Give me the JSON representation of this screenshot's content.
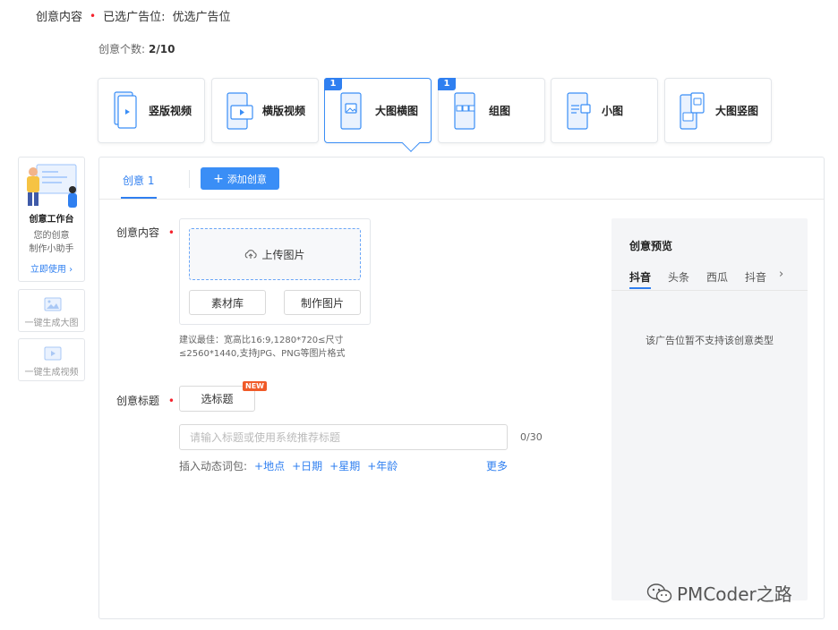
{
  "header": {
    "content_label": "创意内容",
    "selected_label": "已选广告位:",
    "selected_value": "优选广告位"
  },
  "creative_count": {
    "label": "创意个数:",
    "value": "2/10"
  },
  "ad_types": [
    {
      "label": "竖版视频",
      "badge": "",
      "icon": "vertical-video-icon"
    },
    {
      "label": "横版视频",
      "badge": "",
      "icon": "horizontal-video-icon"
    },
    {
      "label": "大图横图",
      "badge": "1",
      "icon": "large-horizontal-image-icon",
      "active": true
    },
    {
      "label": "组图",
      "badge": "1",
      "icon": "image-group-icon"
    },
    {
      "label": "小图",
      "badge": "",
      "icon": "small-image-icon"
    },
    {
      "label": "大图竖图",
      "badge": "",
      "icon": "large-vertical-image-icon"
    }
  ],
  "assistant": {
    "title": "创意工作台",
    "line1": "您的创意",
    "line2": "制作小助手",
    "cta": "立即使用 ›"
  },
  "tools": [
    {
      "label": "一键生成大图",
      "icon": "image-icon"
    },
    {
      "label": "一键生成视频",
      "icon": "video-icon"
    }
  ],
  "tabs": {
    "active_tab": "创意 1",
    "add_label": "添加创意"
  },
  "content_section": {
    "label": "创意内容",
    "upload_label": "上传图片",
    "library_label": "素材库",
    "make_label": "制作图片",
    "hint": "建议最佳：宽高比16:9,1280*720≤尺寸≤2560*1440,支持JPG、PNG等图片格式"
  },
  "title_section": {
    "label": "创意标题",
    "pick_label": "选标题",
    "new_badge": "NEW",
    "input_placeholder": "请输入标题或使用系统推荐标题",
    "input_value": "",
    "counter": "0/30",
    "dynamic_label": "插入动态词包:",
    "dynamic_words": [
      "+地点",
      "+日期",
      "+星期",
      "+年龄"
    ],
    "more_label": "更多"
  },
  "preview": {
    "title": "创意预览",
    "tabs": [
      "抖音",
      "头条",
      "西瓜",
      "抖音"
    ],
    "message": "该广告位暂不支持该创意类型"
  },
  "watermark": "PMCoder之路",
  "colors": {
    "accent": "#2f7ff0",
    "required": "#f5222d",
    "new_badge": "#f05a28"
  }
}
